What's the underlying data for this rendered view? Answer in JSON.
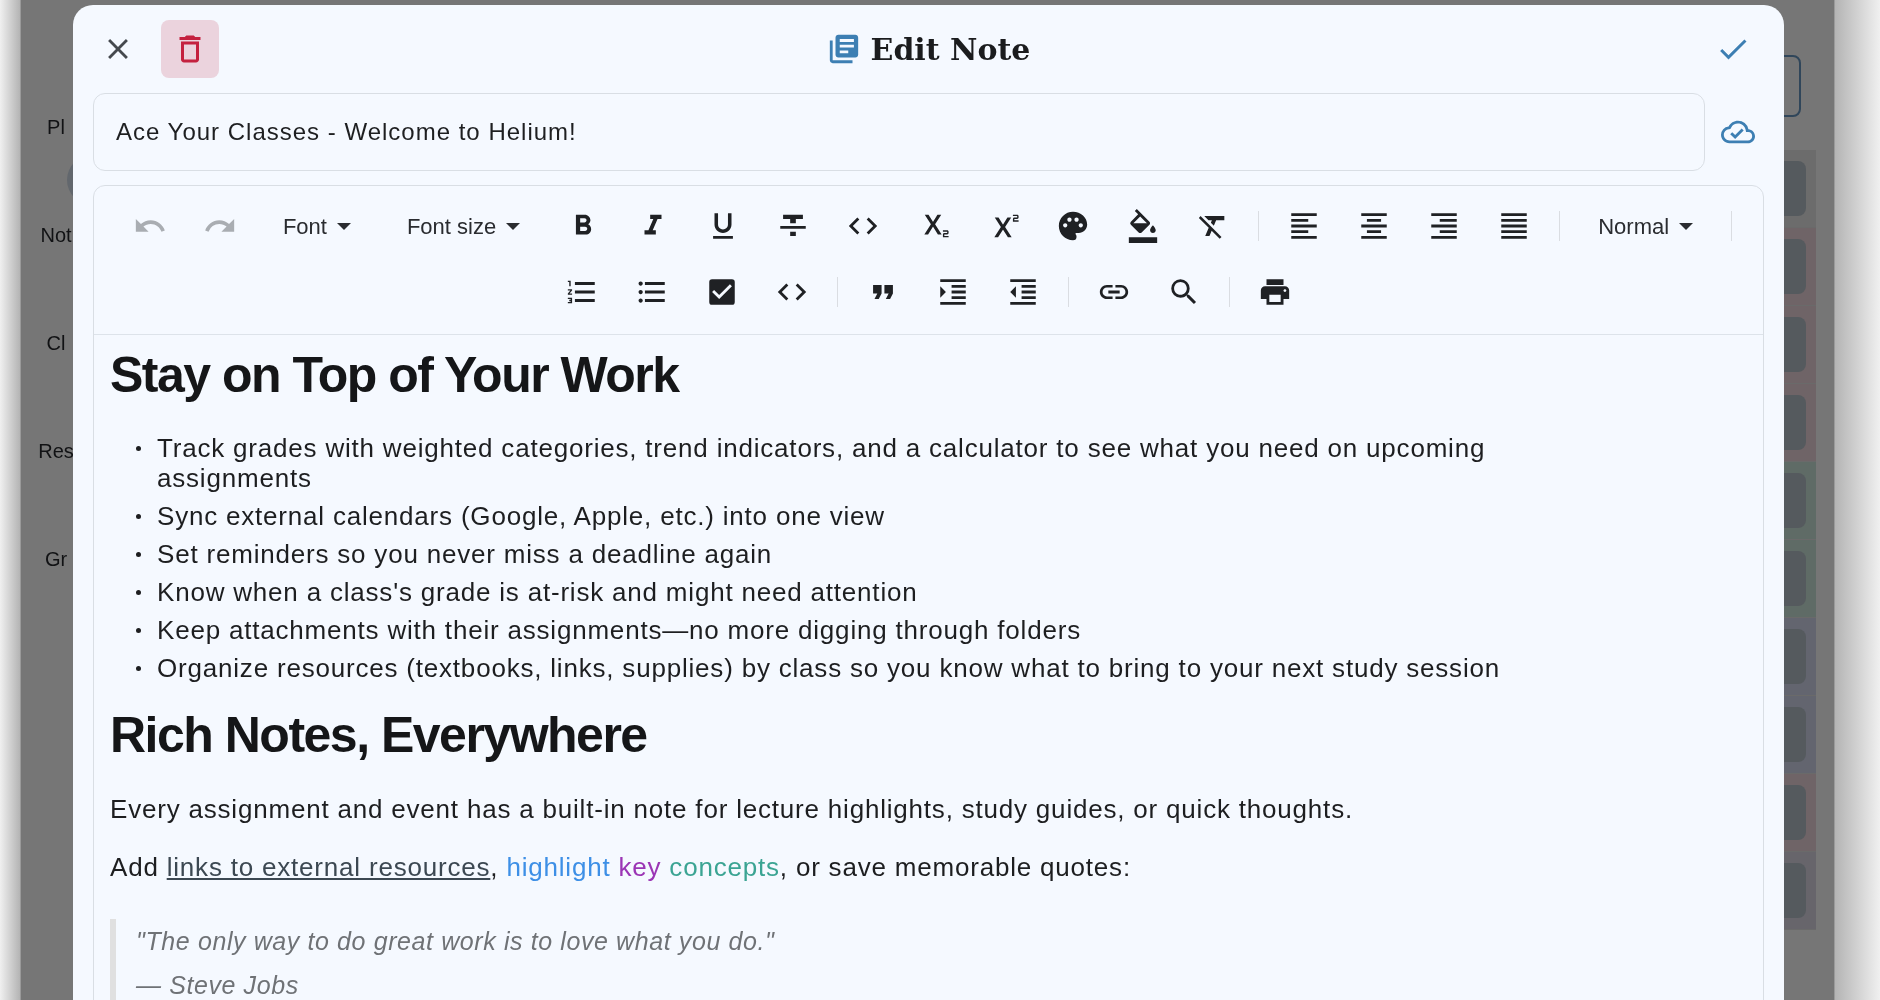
{
  "background": {
    "nav_labels": [
      {
        "label": "Pl"
      },
      {
        "label": "Not"
      },
      {
        "label": "Cl"
      },
      {
        "label": "Res"
      },
      {
        "label": "Gr"
      }
    ]
  },
  "dialog": {
    "title": "Edit Note",
    "title_field": {
      "value": "Ace Your Classes - Welcome to Helium!"
    }
  },
  "toolbar": {
    "rows": [
      [
        {
          "kind": "button",
          "disabled": true
        },
        {
          "kind": "button",
          "disabled": true
        },
        {
          "kind": "dropdown",
          "label": "Font"
        },
        {
          "kind": "dropdown",
          "label": "Font size"
        },
        {
          "kind": "button",
          "disabled": false
        },
        {
          "kind": "button",
          "disabled": false
        },
        {
          "kind": "button",
          "disabled": false
        },
        {
          "kind": "button",
          "disabled": false
        },
        {
          "kind": "button",
          "disabled": false
        },
        {
          "kind": "button",
          "disabled": false
        },
        {
          "kind": "button",
          "disabled": false
        },
        {
          "kind": "button",
          "disabled": false
        },
        {
          "kind": "button",
          "disabled": false
        },
        {
          "kind": "button",
          "disabled": false
        },
        {
          "kind": "separator"
        },
        {
          "kind": "button",
          "disabled": false
        },
        {
          "kind": "button",
          "disabled": false
        },
        {
          "kind": "button",
          "disabled": false
        },
        {
          "kind": "button",
          "disabled": false
        },
        {
          "kind": "separator"
        },
        {
          "kind": "dropdown",
          "label": "Normal"
        },
        {
          "kind": "separator"
        }
      ],
      [
        {
          "kind": "button",
          "disabled": false
        },
        {
          "kind": "button",
          "disabled": false
        },
        {
          "kind": "button",
          "disabled": false
        },
        {
          "kind": "button",
          "disabled": false
        },
        {
          "kind": "separator"
        },
        {
          "kind": "button",
          "disabled": false
        },
        {
          "kind": "button",
          "disabled": false
        },
        {
          "kind": "button",
          "disabled": false
        },
        {
          "kind": "separator"
        },
        {
          "kind": "button",
          "disabled": false
        },
        {
          "kind": "button",
          "disabled": false
        },
        {
          "kind": "separator"
        },
        {
          "kind": "button",
          "disabled": false
        }
      ]
    ]
  },
  "content": [
    {
      "kind": "heading",
      "text": "Stay on Top of Your Work"
    },
    {
      "kind": "bullets",
      "items": [
        "Track grades with weighted categories, trend indicators, and a calculator to see what you need on upcoming assignments",
        "Sync external calendars (Google, Apple, etc.) into one view",
        "Set reminders so you never miss a deadline again",
        "Know when a class's grade is at-risk and might need attention",
        "Keep attachments with their assignments—no more digging through folders",
        "Organize resources (textbooks, links, supplies) by class so you know what to bring to your next study session"
      ]
    },
    {
      "kind": "heading",
      "text": "Rich Notes, Everywhere"
    },
    {
      "kind": "paragraph",
      "segments": [
        {
          "kind": "text",
          "text": "Every assignment and event has a built-in note for lecture highlights, study guides, or quick thoughts."
        }
      ]
    },
    {
      "kind": "paragraph",
      "segments": [
        {
          "kind": "text",
          "text": "Add "
        },
        {
          "kind": "link",
          "text": "links to external resources"
        },
        {
          "kind": "text",
          "text": ", "
        },
        {
          "kind": "colored",
          "text": "highlight",
          "color": "#3d8fe6"
        },
        {
          "kind": "colored",
          "text": " key",
          "color": "#9b35b5"
        },
        {
          "kind": "colored",
          "text": " concepts",
          "color": "#3ba493"
        },
        {
          "kind": "text",
          "text": ", or save memorable quotes:"
        }
      ]
    },
    {
      "kind": "quote",
      "lines": [
        "\"The only way to do great work is to love what you do.\"",
        "— Steve Jobs"
      ]
    }
  ]
}
